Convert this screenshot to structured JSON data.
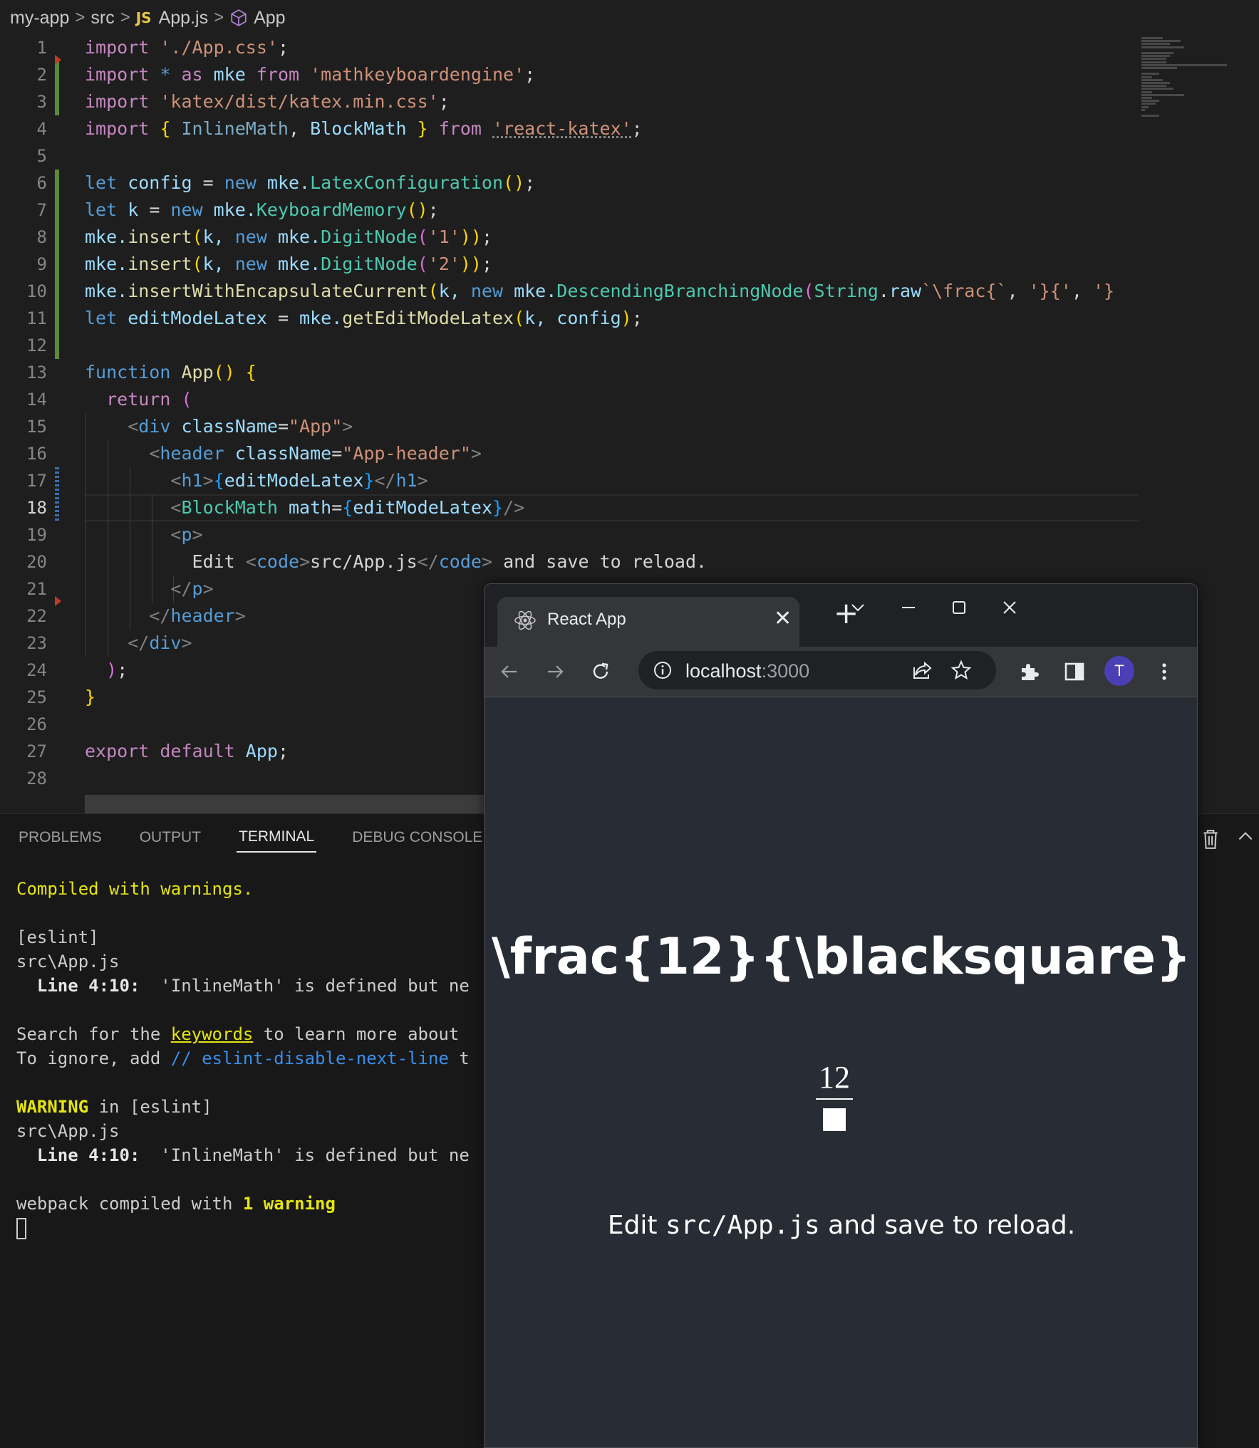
{
  "breadcrumb": {
    "project": "my-app",
    "folder": "src",
    "file_badge": "JS",
    "file": "App.js",
    "symbol": "App",
    "sep": ">"
  },
  "editor": {
    "line_numbers": [
      "1",
      "2",
      "3",
      "4",
      "5",
      "6",
      "7",
      "8",
      "9",
      "10",
      "11",
      "12",
      "13",
      "14",
      "15",
      "16",
      "17",
      "18",
      "19",
      "20",
      "21",
      "22",
      "23",
      "24",
      "25",
      "26",
      "27",
      "28"
    ],
    "current_line": "18",
    "lines": {
      "l1_kw": "import",
      "l1_str": "'./App.css'",
      "l1_end": ";",
      "l2_kw": "import",
      "l2_star": " * ",
      "l2_as": "as",
      "l2_name": " mke ",
      "l2_from": "from",
      "l2_str": " 'mathkeyboardengine'",
      "l2_end": ";",
      "l3_kw": "import",
      "l3_str": " 'katex/dist/katex.min.css'",
      "l3_end": ";",
      "l4_kw": "import",
      "l4_open": " { ",
      "l4_a": "InlineMath",
      "l4_comma": ", ",
      "l4_b": "BlockMath",
      "l4_close": " } ",
      "l4_from": "from",
      "l4_space": " ",
      "l4_str": "'react-katex'",
      "l4_end": ";",
      "l6_let": "let",
      "l6_var": " config ",
      "l6_eq": "= ",
      "l6_new": "new",
      "l6_obj": " mke.",
      "l6_cls": "LatexConfiguration",
      "l6_paren": "()",
      "l6_end": ";",
      "l7_let": "let",
      "l7_var": " k ",
      "l7_eq": "= ",
      "l7_new": "new",
      "l7_obj": " mke.",
      "l7_cls": "KeyboardMemory",
      "l7_paren": "()",
      "l7_end": ";",
      "l8_obj": "mke.",
      "l8_fn": "insert",
      "l8_p": "(",
      "l8_k": "k, ",
      "l8_new": "new",
      "l8_obj2": " mke.",
      "l8_cls": "DigitNode",
      "l8_p2": "(",
      "l8_str": "'1'",
      "l8_close": "))",
      "l8_end": ";",
      "l9_obj": "mke.",
      "l9_fn": "insert",
      "l9_p": "(",
      "l9_k": "k, ",
      "l9_new": "new",
      "l9_obj2": " mke.",
      "l9_cls": "DigitNode",
      "l9_p2": "(",
      "l9_str": "'2'",
      "l9_close": "))",
      "l9_end": ";",
      "l10_obj": "mke.",
      "l10_fn": "insertWithEncapsulateCurrent",
      "l10_p": "(",
      "l10_k": "k, ",
      "l10_new": "new",
      "l10_obj2": " mke.",
      "l10_cls": "DescendingBranchingNode",
      "l10_p2": "(",
      "l10_string": "String",
      "l10_dot": ".",
      "l10_raw": "raw",
      "l10_tpl": "`\\frac{`",
      "l10_sep": ", ",
      "l10_s2": "'}{'",
      "l10_sep2": ", ",
      "l10_s3": "'}",
      "l11_let": "let",
      "l11_var": " editModeLatex ",
      "l11_eq": "= ",
      "l11_obj": "mke.",
      "l11_fn": "getEditModeLatex",
      "l11_p": "(",
      "l11_args": "k, config",
      "l11_close": ")",
      "l11_end": ";",
      "l13_fn_kw": "function",
      "l13_name": " App",
      "l13_paren": "()",
      "l13_brace": " {",
      "l14_ret": "return",
      "l14_p": " (",
      "l15_lt": "<",
      "l15_tag": "div",
      "l15_attr": " className",
      "l15_eq": "=",
      "l15_str": "\"App\"",
      "l15_gt": ">",
      "l16_lt": "<",
      "l16_tag": "header",
      "l16_attr": " className",
      "l16_eq": "=",
      "l16_str": "\"App-header\"",
      "l16_gt": ">",
      "l17_lt": "<",
      "l17_tag": "h1",
      "l17_gt": ">",
      "l17_ob": "{",
      "l17_var": "editModeLatex",
      "l17_cb": "}",
      "l17_lt2": "</",
      "l17_tag2": "h1",
      "l17_gt2": ">",
      "l18_lt": "<",
      "l18_comp": "BlockMath",
      "l18_attr": " math",
      "l18_eq": "=",
      "l18_ob": "{",
      "l18_var": "editModeLatex",
      "l18_cb": "}",
      "l18_end": "/>",
      "l19_lt": "<",
      "l19_tag": "p",
      "l19_gt": ">",
      "l20_text": "Edit ",
      "l20_lt": "<",
      "l20_tag": "code",
      "l20_gt": ">",
      "l20_inner": "src/App.js",
      "l20_lt2": "</",
      "l20_tag2": "code",
      "l20_gt2": ">",
      "l20_tail": " and save to reload.",
      "l21_lt": "</",
      "l21_tag": "p",
      "l21_gt": ">",
      "l22_lt": "</",
      "l22_tag": "header",
      "l22_gt": ">",
      "l23_lt": "</",
      "l23_tag": "div",
      "l23_gt": ">",
      "l24_p": ")",
      "l24_end": ";",
      "l25_brace": "}",
      "l27_export": "export",
      "l27_default": " default",
      "l27_name": " App",
      "l27_end": ";"
    }
  },
  "panel": {
    "tabs": [
      "PROBLEMS",
      "OUTPUT",
      "TERMINAL",
      "DEBUG CONSOLE"
    ],
    "active_tab": "TERMINAL",
    "terminal": {
      "t1": "Compiled with warnings.",
      "t2": "[eslint]",
      "t3": "src\\App.js",
      "t4_a": "  ",
      "t4_b": "Line 4:10:",
      "t4_c": "  'InlineMath' is defined but ne",
      "t5_a": "Search for the ",
      "t5_link": "keywords",
      "t5_b": " to learn more about",
      "t6_a": "To ignore, add ",
      "t6_b": "// eslint-disable-next-line",
      "t6_c": " t",
      "t7_a": "WARNING",
      "t7_b": " in [eslint]",
      "t8": "src\\App.js",
      "t9_a": "  ",
      "t9_b": "Line 4:10:",
      "t9_c": "  'InlineMath' is defined but ne",
      "t10_a": "webpack compiled with ",
      "t10_b": "1 warning"
    }
  },
  "browser": {
    "tab_title": "React App",
    "tab_close": "✕",
    "new_tab": "+",
    "url_host": "localhost",
    "url_port": ":3000",
    "avatar_letter": "T",
    "page": {
      "heading": "\\frac{12}{\\blacksquare}",
      "fraction_numerator": "12",
      "paragraph_before": "Edit ",
      "paragraph_code": "src/App.js",
      "paragraph_after": " and save to reload."
    }
  },
  "icons": {
    "breadcrumb_symbol": "cube-icon",
    "react": "react-logo-icon",
    "back": "arrow-left-icon",
    "forward": "arrow-right-icon",
    "reload": "reload-icon",
    "info": "info-icon",
    "share": "share-icon",
    "star": "star-icon",
    "extensions": "puzzle-icon",
    "side_panel": "side-panel-icon",
    "menu": "kebab-menu-icon",
    "trash": "trash-icon",
    "collapse": "chevron-up-icon"
  }
}
